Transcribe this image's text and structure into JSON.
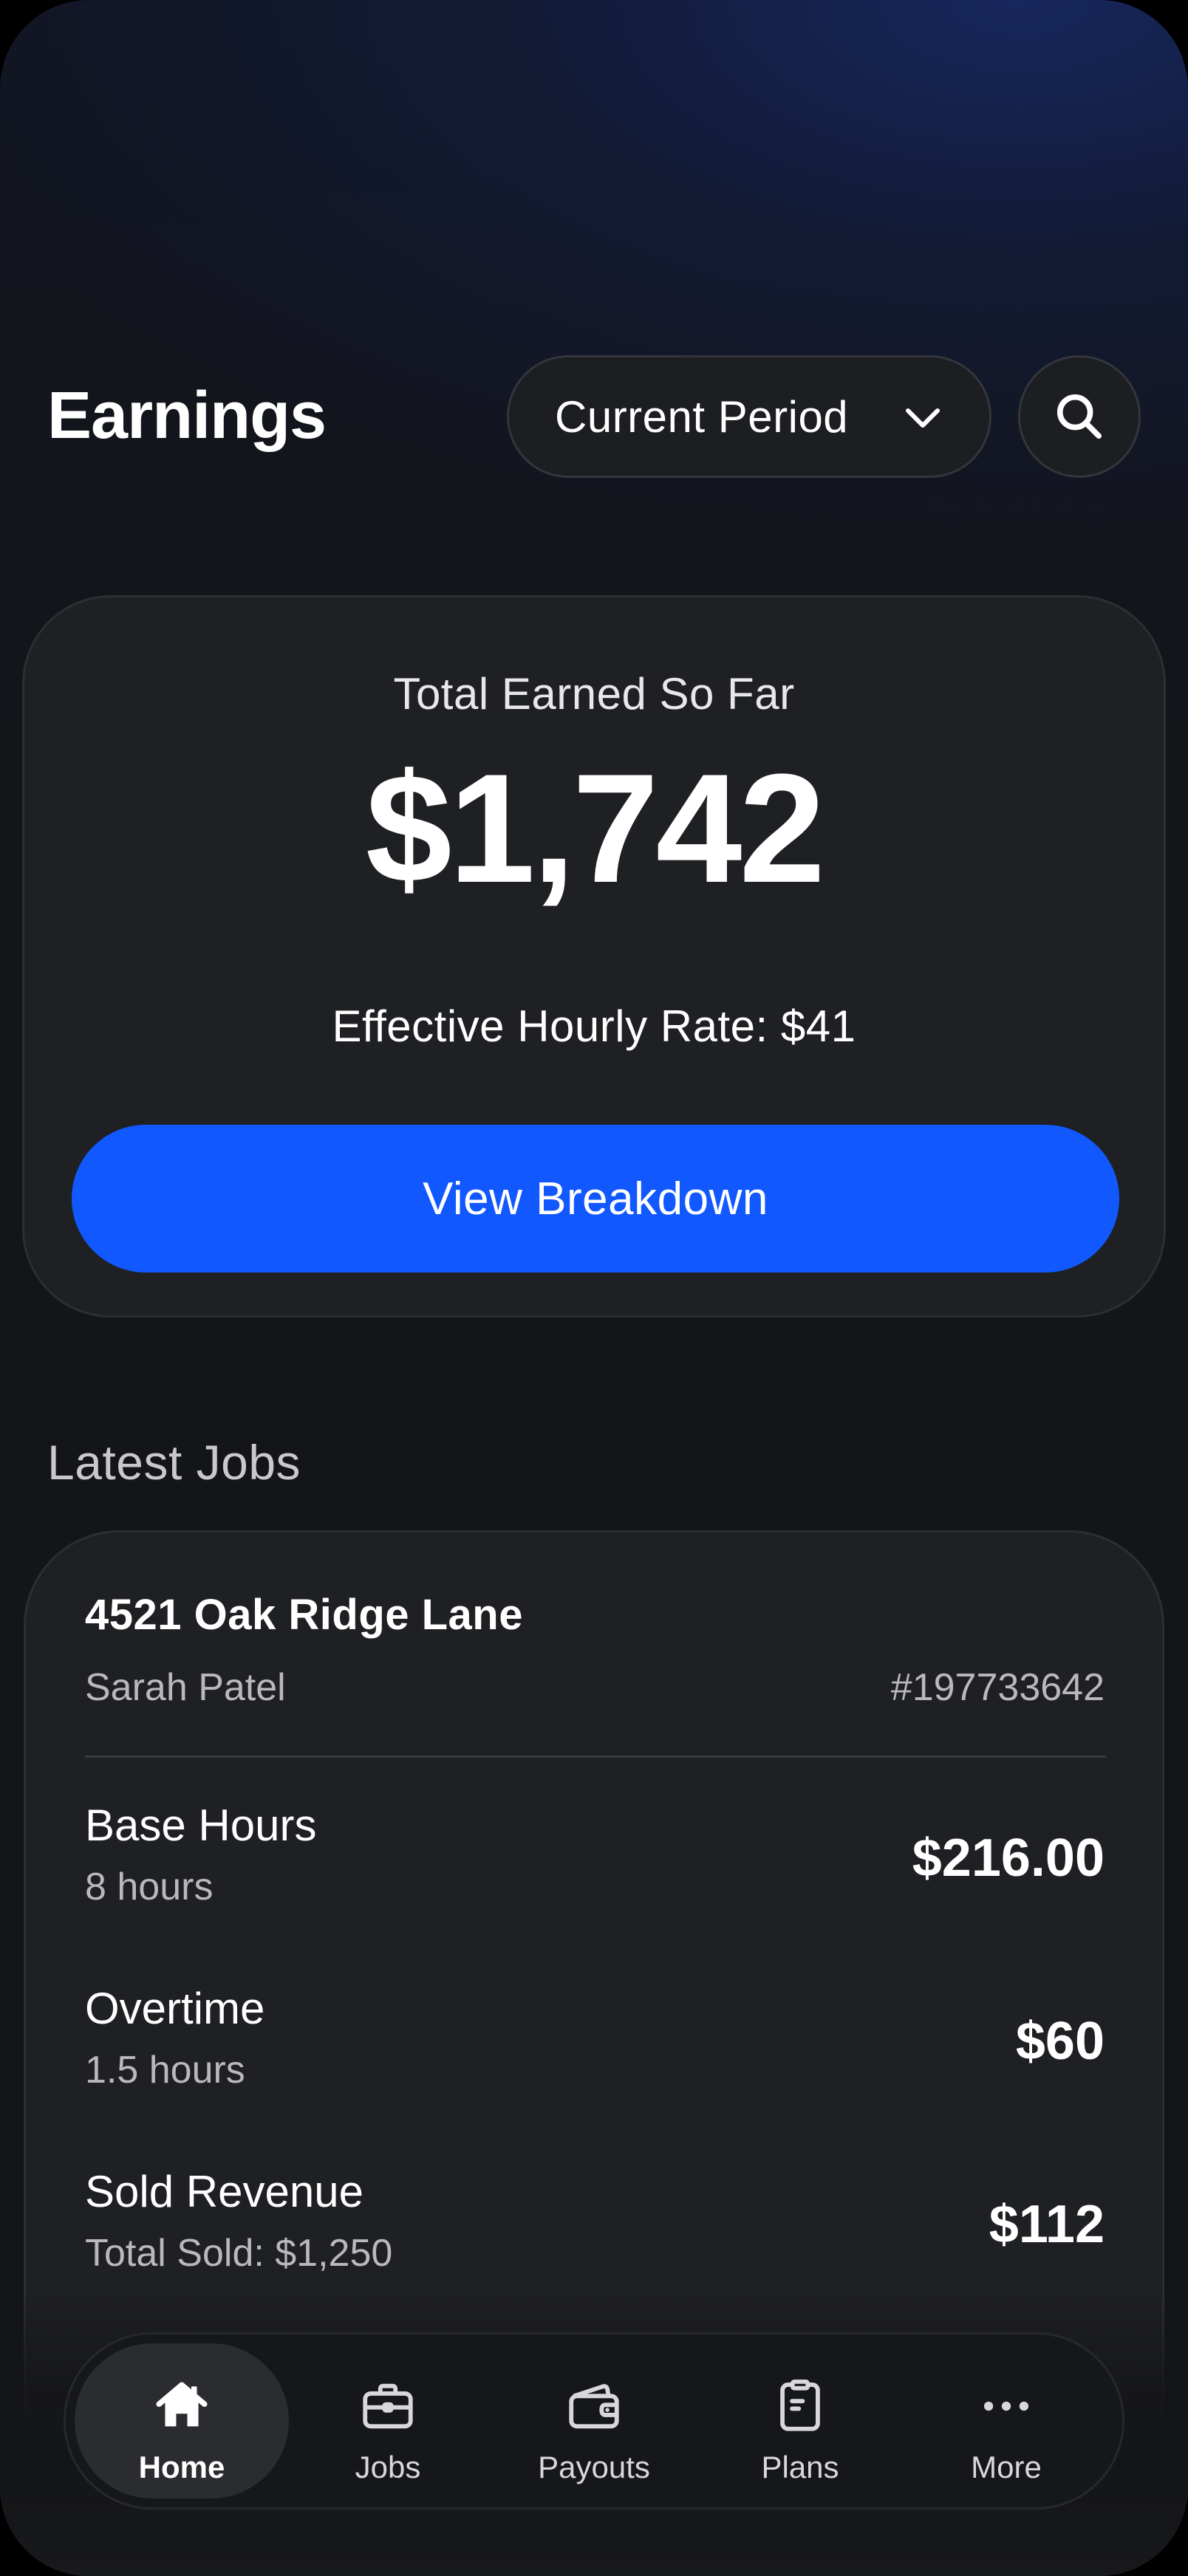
{
  "header": {
    "title": "Earnings",
    "period_select": {
      "label": "Current Period",
      "icon": "chevron-down-icon"
    },
    "search": {
      "icon": "search-icon"
    }
  },
  "summary": {
    "label": "Total Earned So Far",
    "amount": "$1,742",
    "rate_text": "Effective Hourly Rate: $41",
    "button_label": "View Breakdown",
    "button_color": "#1158ff"
  },
  "latest_jobs": {
    "title": "Latest Jobs",
    "job": {
      "address": "4521 Oak Ridge Lane",
      "customer": "Sarah Patel",
      "number": "#197733642",
      "items": [
        {
          "title": "Base Hours",
          "subtitle": "8 hours",
          "amount": "$216.00"
        },
        {
          "title": "Overtime",
          "subtitle": "1.5 hours",
          "amount": "$60"
        },
        {
          "title": "Sold Revenue",
          "subtitle": "Total Sold: $1,250",
          "amount": "$112"
        }
      ]
    }
  },
  "nav": {
    "items": [
      {
        "label": "Home",
        "icon": "home-icon",
        "active": true
      },
      {
        "label": "Jobs",
        "icon": "briefcase-icon",
        "active": false
      },
      {
        "label": "Payouts",
        "icon": "wallet-icon",
        "active": false
      },
      {
        "label": "Plans",
        "icon": "clipboard-icon",
        "active": false
      },
      {
        "label": "More",
        "icon": "more-icon",
        "active": false
      }
    ]
  }
}
